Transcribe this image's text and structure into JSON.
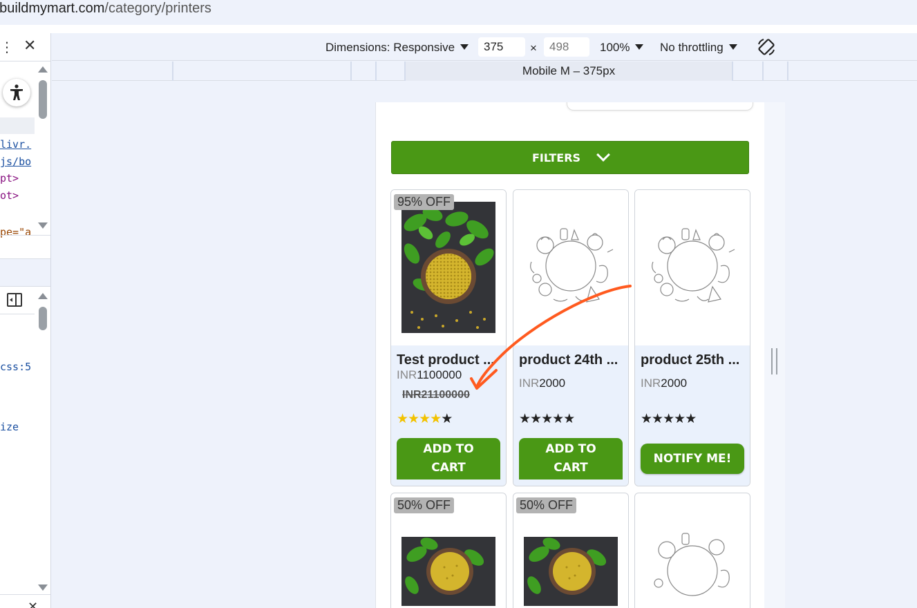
{
  "browser": {
    "url_domain": "ebuildmymart.com",
    "url_path": "/category/printers"
  },
  "devtools": {
    "code_lines": [
      {
        "text": "livr.",
        "kind": "link"
      },
      {
        "text": "js/bo",
        "kind": "link"
      },
      {
        "text": "pt>",
        "kind": "tag"
      },
      {
        "text": "ot>",
        "kind": "tag"
      },
      {
        "text": "pe=\"a",
        "kind": "attr"
      },
      {
        "text": "css:5",
        "kind": "link"
      },
      {
        "text": "ize",
        "kind": "blue"
      }
    ],
    "accent_color": "#1a4fa0"
  },
  "device_toolbar": {
    "dimensions_label": "Dimensions: Responsive",
    "width_value": "375",
    "height_placeholder": "498",
    "times": "×",
    "zoom": "100%",
    "throttling": "No throttling"
  },
  "media_query_bar": {
    "device_label": "Mobile M – 375px"
  },
  "page": {
    "brand_color": "#4a9815",
    "filters_label": "FILTERS",
    "products": [
      {
        "badge": "95% OFF",
        "name": "Test product ...",
        "currency": "INR",
        "price": "1100000",
        "old_price": "INR21100000",
        "rating": 4,
        "max_rating": 5,
        "action_label_1": "ADD TO",
        "action_label_2": "CART",
        "image": "fenugreek-photo"
      },
      {
        "badge": "",
        "name": "product 24th ...",
        "currency": "INR",
        "price": "2000",
        "old_price": "",
        "rating": 0,
        "max_rating": 5,
        "action_label_1": "ADD TO",
        "action_label_2": "CART",
        "image": "placeholder-sketch"
      },
      {
        "badge": "",
        "name": "product 25th ...",
        "currency": "INR",
        "price": "2000",
        "old_price": "",
        "rating": 0,
        "max_rating": 5,
        "action_label_1": "NOTIFY ME!",
        "action_label_2": "",
        "image": "placeholder-sketch"
      },
      {
        "badge": "50% OFF",
        "image": "fenugreek-photo"
      },
      {
        "badge": "50% OFF",
        "image": "fenugreek-photo"
      },
      {
        "badge": "",
        "image": "placeholder-sketch"
      }
    ]
  },
  "annotation": {
    "arrow_color": "#ff5a1f"
  }
}
